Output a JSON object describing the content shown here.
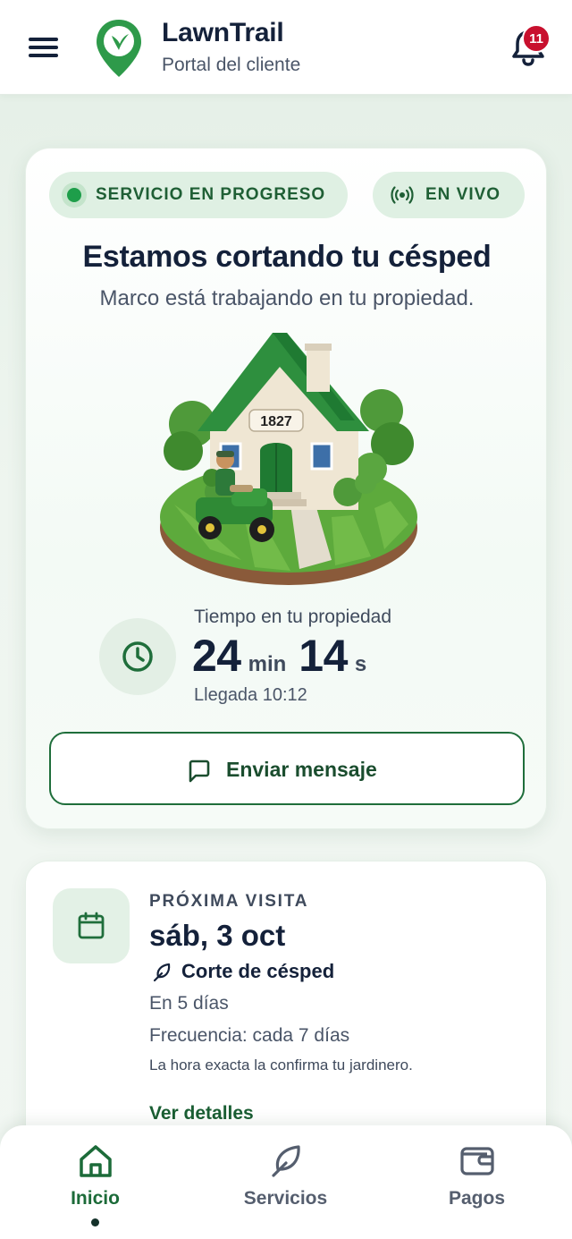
{
  "header": {
    "app_name": "LawnTrail",
    "app_subtitle": "Portal del cliente",
    "notification_count": "11",
    "icons": [
      "menu-icon",
      "logo-pin-icon",
      "bell-icon"
    ]
  },
  "status_card": {
    "status_pill": "SERVICIO EN PROGRESO",
    "live_pill": "EN VIVO",
    "title": "Estamos cortando tu césped",
    "subtitle": "Marco está trabajando en tu propiedad.",
    "house_number": "1827",
    "time_label": "Tiempo en tu propiedad",
    "time_minutes": "24",
    "time_minutes_unit": "min",
    "time_seconds": "14",
    "time_seconds_unit": "s",
    "arrival": "Llegada 10:12",
    "message_button": "Enviar mensaje"
  },
  "next_visit": {
    "label": "PRÓXIMA VISITA",
    "date": "sáb, 3 oct",
    "service": "Corte de césped",
    "in_days": "En 5 días",
    "frequency": "Frecuencia: cada 7 días",
    "note": "La hora exacta la confirma tu jardinero.",
    "details_link": "Ver detalles"
  },
  "bottom_nav": {
    "items": [
      {
        "label": "Inicio",
        "icon": "home-icon",
        "active": true
      },
      {
        "label": "Servicios",
        "icon": "leaf-icon",
        "active": false
      },
      {
        "label": "Pagos",
        "icon": "wallet-icon",
        "active": false
      }
    ]
  },
  "colors": {
    "brand_green": "#1c6b39",
    "status_dot": "#1e9e4a",
    "pill_bg": "#dff0e3",
    "badge_red": "#c8102e",
    "text_dark": "#14213a"
  }
}
